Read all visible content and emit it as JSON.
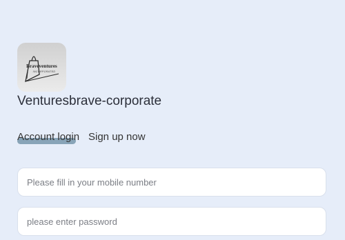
{
  "brand": {
    "logo_text": "Braveventures",
    "logo_subtext": "INCORPORATED",
    "company_name": "Venturesbrave-corporate"
  },
  "tabs": {
    "login_label": "Account login",
    "signup_label": "Sign up now",
    "active": "login"
  },
  "form": {
    "phone_placeholder": "Please fill in your mobile number",
    "password_placeholder": "please enter password"
  },
  "colors": {
    "background": "#e6edf9",
    "tab_indicator": "#7797ad"
  }
}
